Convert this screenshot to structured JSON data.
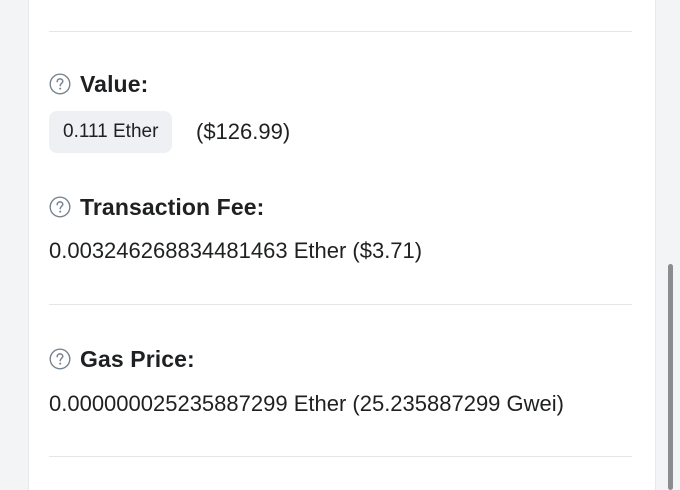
{
  "value": {
    "label": "Value:",
    "amount_pill": "0.111 Ether",
    "usd": "($126.99)"
  },
  "transaction_fee": {
    "label": "Transaction Fee:",
    "amount": "0.003246268834481463 Ether ($3.71)"
  },
  "gas_price": {
    "label": "Gas Price:",
    "amount": "0.000000025235887299 Ether (25.235887299 Gwei)"
  },
  "icons": {
    "help": "question-circle-icon"
  },
  "colors": {
    "text": "#1e2022",
    "muted_icon": "#77838f",
    "pill_bg": "#eef0f3",
    "divider": "#e4e6ea"
  }
}
